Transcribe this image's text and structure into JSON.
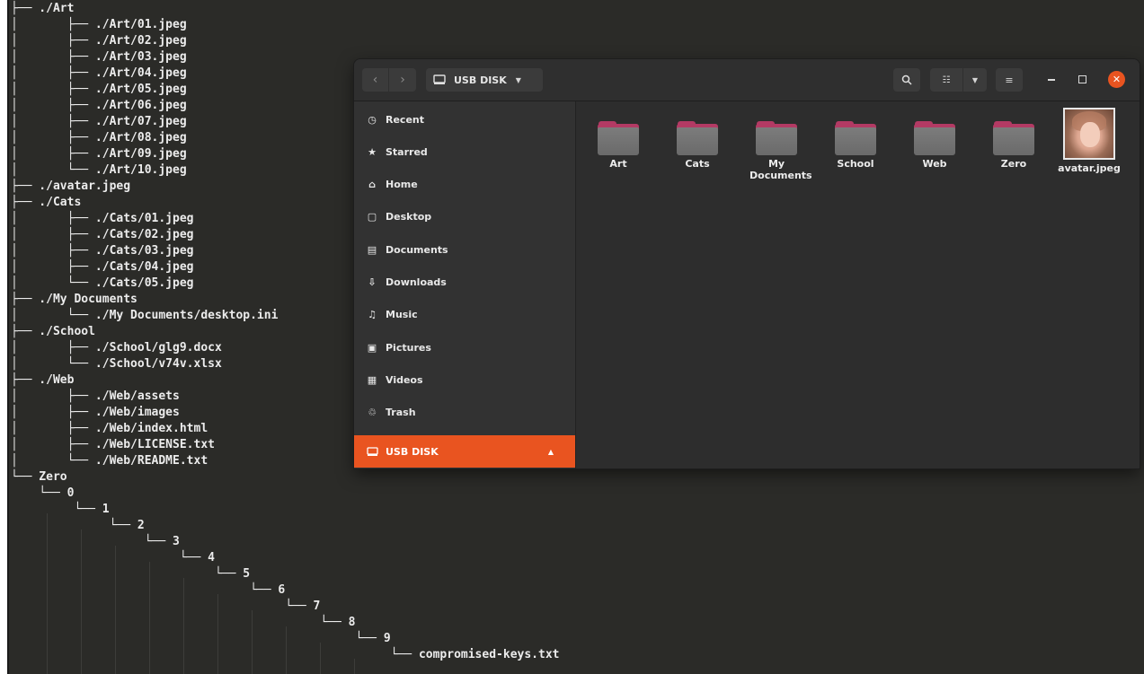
{
  "terminal": {
    "lines": [
      "├── ./Art",
      "│       ├── ./Art/01.jpeg",
      "│       ├── ./Art/02.jpeg",
      "│       ├── ./Art/03.jpeg",
      "│       ├── ./Art/04.jpeg",
      "│       ├── ./Art/05.jpeg",
      "│       ├── ./Art/06.jpeg",
      "│       ├── ./Art/07.jpeg",
      "│       ├── ./Art/08.jpeg",
      "│       ├── ./Art/09.jpeg",
      "│       └── ./Art/10.jpeg",
      "├── ./avatar.jpeg",
      "├── ./Cats",
      "│       ├── ./Cats/01.jpeg",
      "│       ├── ./Cats/02.jpeg",
      "│       ├── ./Cats/03.jpeg",
      "│       ├── ./Cats/04.jpeg",
      "│       └── ./Cats/05.jpeg",
      "├── ./My Documents",
      "│       └── ./My Documents/desktop.ini",
      "├── ./School",
      "│       ├── ./School/glg9.docx",
      "│       └── ./School/v74v.xlsx",
      "├── ./Web",
      "│       ├── ./Web/assets",
      "│       ├── ./Web/images",
      "│       ├── ./Web/index.html",
      "│       ├── ./Web/LICENSE.txt",
      "│       └── ./Web/README.txt",
      "└── Zero",
      "    └── 0",
      "         └── 1",
      "              └── 2",
      "                   └── 3",
      "                        └── 4",
      "                             └── 5",
      "                                  └── 6",
      "                                       └── 7",
      "                                            └── 8",
      "                                                 └── 9",
      "                                                      └── compromised-keys.txt"
    ]
  },
  "file_manager": {
    "location": "USB DISK",
    "sidebar": [
      {
        "label": "Recent",
        "icon": "clock-icon",
        "glyph": "◷"
      },
      {
        "label": "Starred",
        "icon": "star-icon",
        "glyph": "★"
      },
      {
        "label": "Home",
        "icon": "home-icon",
        "glyph": "⌂"
      },
      {
        "label": "Desktop",
        "icon": "desktop-icon",
        "glyph": "▢"
      },
      {
        "label": "Documents",
        "icon": "document-icon",
        "glyph": "▤"
      },
      {
        "label": "Downloads",
        "icon": "download-icon",
        "glyph": "⇩"
      },
      {
        "label": "Music",
        "icon": "music-icon",
        "glyph": "♫"
      },
      {
        "label": "Pictures",
        "icon": "picture-icon",
        "glyph": "▣"
      },
      {
        "label": "Videos",
        "icon": "video-icon",
        "glyph": "▦"
      },
      {
        "label": "Trash",
        "icon": "trash-icon",
        "glyph": "♲"
      }
    ],
    "device": {
      "label": "USB DISK",
      "icon": "drive-icon",
      "eject_icon": "eject-icon"
    },
    "items": [
      {
        "label": "Art",
        "type": "folder"
      },
      {
        "label": "Cats",
        "type": "folder"
      },
      {
        "label": "My Documents",
        "type": "folder"
      },
      {
        "label": "School",
        "type": "folder"
      },
      {
        "label": "Web",
        "type": "folder"
      },
      {
        "label": "Zero",
        "type": "folder"
      },
      {
        "label": "avatar.jpeg",
        "type": "image"
      }
    ],
    "colors": {
      "accent": "#e95420",
      "folder_tab": "#b33a64",
      "close": "#e95420"
    }
  }
}
